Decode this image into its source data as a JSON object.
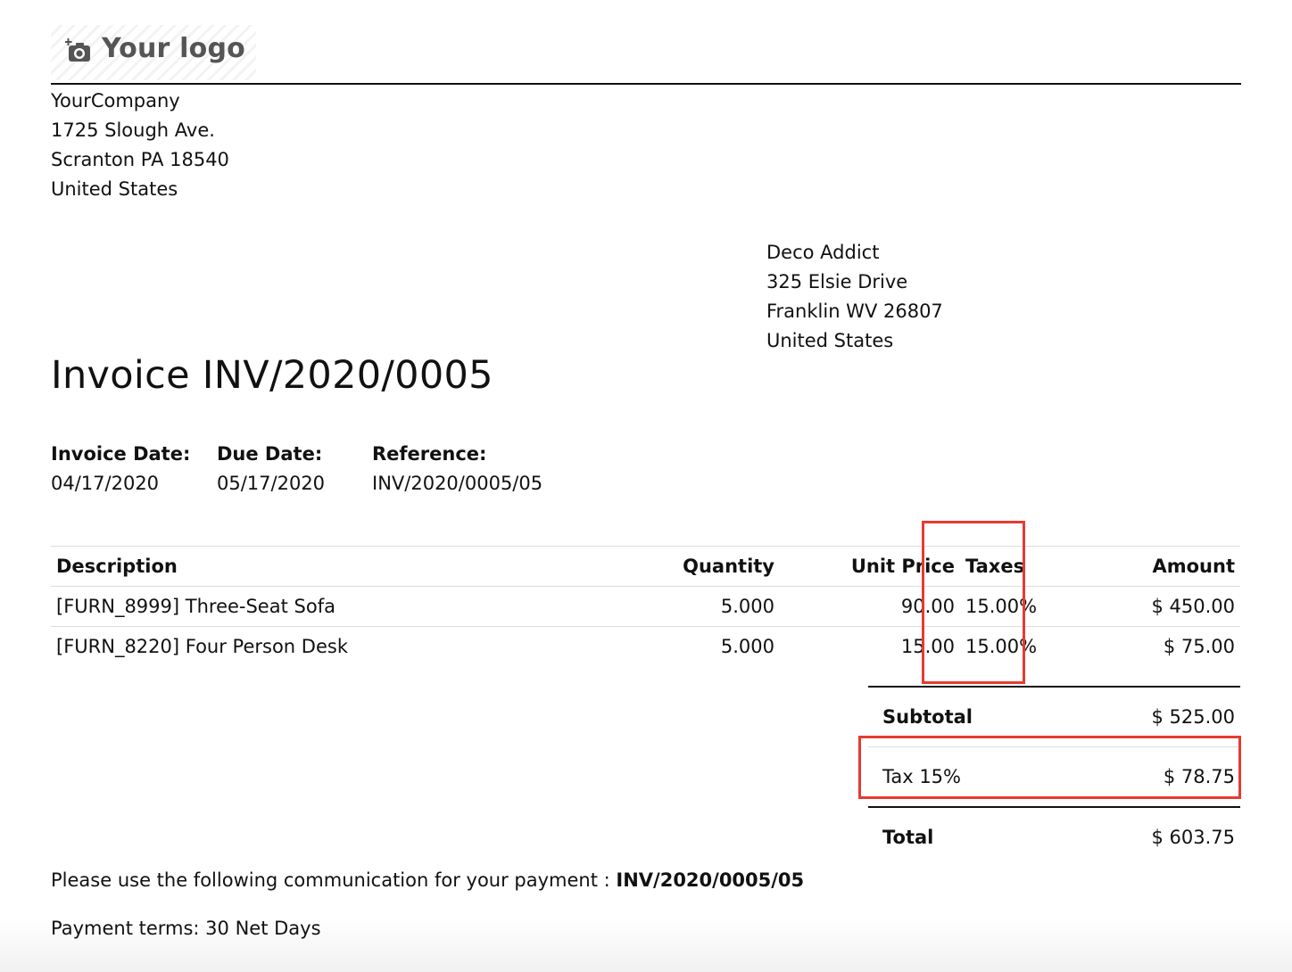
{
  "logo": {
    "text": "Your logo",
    "icon": "camera-plus-icon"
  },
  "company": {
    "name": "YourCompany",
    "street": "1725 Slough Ave.",
    "city_line": "Scranton PA 18540",
    "country": "United States"
  },
  "partner": {
    "name": "Deco Addict",
    "street": "325 Elsie Drive",
    "city_line": "Franklin WV 26807",
    "country": "United States"
  },
  "invoice": {
    "title": "Invoice INV/2020/0005",
    "info": [
      {
        "label": "Invoice Date:",
        "value": "04/17/2020"
      },
      {
        "label": "Due Date:",
        "value": "05/17/2020"
      },
      {
        "label": "Reference:",
        "value": "INV/2020/0005/05"
      }
    ]
  },
  "lines": {
    "headers": {
      "description": "Description",
      "quantity": "Quantity",
      "unit_price": "Unit Price",
      "taxes": "Taxes",
      "amount": "Amount"
    },
    "rows": [
      {
        "description": "[FURN_8999] Three-Seat Sofa",
        "quantity": "5.000",
        "unit_price": "90.00",
        "taxes": "15.00%",
        "amount": "$ 450.00"
      },
      {
        "description": "[FURN_8220] Four Person Desk",
        "quantity": "5.000",
        "unit_price": "15.00",
        "taxes": "15.00%",
        "amount": "$ 75.00"
      }
    ]
  },
  "totals": {
    "subtotal_label": "Subtotal",
    "subtotal_value": "$ 525.00",
    "tax_label": "Tax 15%",
    "tax_value": "$ 78.75",
    "total_label": "Total",
    "total_value": "$ 603.75"
  },
  "payment": {
    "communication_text": "Please use the following communication for your payment : ",
    "communication_ref": "INV/2020/0005/05",
    "terms": "Payment terms: 30 Net Days"
  },
  "annotations": {
    "highlight_color": "#e63b32"
  }
}
